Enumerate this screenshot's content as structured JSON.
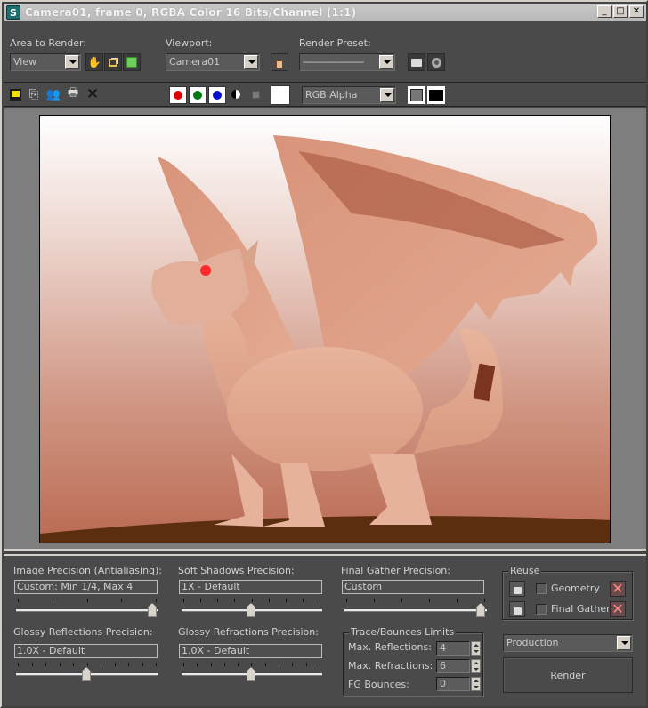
{
  "window": {
    "title": "Camera01, frame 0, RGBA Color 16 Bits/Channel (1:1)",
    "app_icon": "3dsmax-logo",
    "controls": [
      "minimize",
      "maximize",
      "close"
    ]
  },
  "top": {
    "area_to_render": {
      "label": "Area to Render:",
      "value": "View"
    },
    "viewport": {
      "label": "Viewport:",
      "value": "Camera01"
    },
    "render_preset": {
      "label": "Render Preset:",
      "value": "-----------------------"
    },
    "area_icons": [
      "pan-hand-icon",
      "region-select-icon",
      "auto-region-icon"
    ],
    "viewport_lock_icon": "lock-icon",
    "preset_icons": [
      "render-setup-icon",
      "environment-effects-icon"
    ]
  },
  "toolbar": {
    "file_icons": [
      "save-icon",
      "copy-icon",
      "clone-icon",
      "print-icon",
      "clear-icon"
    ],
    "channels": [
      {
        "name": "red",
        "color": "#e00000"
      },
      {
        "name": "green",
        "color": "#007a10"
      },
      {
        "name": "blue",
        "color": "#0010d0"
      }
    ],
    "monochrome_icon": "monochrome-icon",
    "alpha_icon": "alpha-icon",
    "swatch_color": "#ffffff",
    "channel_display": "RGB Alpha",
    "display_icons": [
      "frame-buffer-icon",
      "background-icon"
    ]
  },
  "bottom": {
    "image_precision": {
      "label": "Image Precision (Antialiasing):",
      "value": "Custom: Min 1/4, Max 4",
      "slider": 1.0
    },
    "soft_shadows": {
      "label": "Soft Shadows Precision:",
      "value": "1X - Default",
      "slider": 0.5
    },
    "final_gather": {
      "label": "Final Gather Precision:",
      "value": "Custom",
      "slider": 1.0
    },
    "glossy_reflections": {
      "label": "Glossy Reflections Precision:",
      "value": "1.0X - Default",
      "slider": 0.5
    },
    "glossy_refractions": {
      "label": "Glossy Refractions Precision:",
      "value": "1.0X - Default",
      "slider": 0.5
    },
    "trace": {
      "title": "Trace/Bounces Limits",
      "rows": [
        {
          "label": "Max. Reflections:",
          "value": "4"
        },
        {
          "label": "Max. Refractions:",
          "value": "6"
        },
        {
          "label": "FG Bounces:",
          "value": "0"
        }
      ]
    },
    "reuse": {
      "title": "Reuse",
      "rows": [
        {
          "label": "Geometry",
          "checked": false
        },
        {
          "label": "Final Gather",
          "checked": false
        }
      ]
    },
    "mode": "Production",
    "render_label": "Render"
  }
}
